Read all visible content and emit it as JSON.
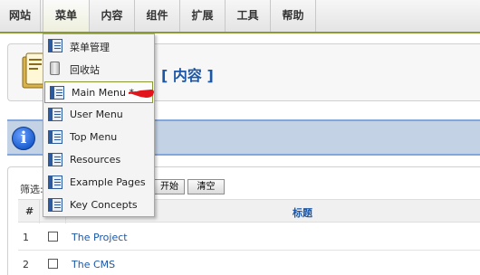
{
  "menubar": {
    "items": [
      {
        "label": "网站"
      },
      {
        "label": "菜单"
      },
      {
        "label": "内容"
      },
      {
        "label": "组件"
      },
      {
        "label": "扩展"
      },
      {
        "label": "工具"
      },
      {
        "label": "帮助"
      }
    ]
  },
  "header": {
    "title": "[ 内容 ]"
  },
  "dropdown": {
    "items": [
      {
        "label": "菜单管理",
        "icon": "menu-list-icon"
      },
      {
        "label": "回收站",
        "icon": "trash-icon"
      },
      {
        "label": "Main Menu *",
        "icon": "menu-list-icon"
      },
      {
        "label": "User Menu",
        "icon": "menu-list-icon"
      },
      {
        "label": "Top Menu",
        "icon": "menu-list-icon"
      },
      {
        "label": "Resources",
        "icon": "menu-list-icon"
      },
      {
        "label": "Example Pages",
        "icon": "menu-list-icon"
      },
      {
        "label": "Key Concepts",
        "icon": "menu-list-icon"
      }
    ]
  },
  "filter": {
    "label": "筛选:",
    "go_label": "开始",
    "reset_label": "清空"
  },
  "table": {
    "headers": {
      "num": "#",
      "title": "标题"
    },
    "rows": [
      {
        "num": "1",
        "title": "The Project"
      },
      {
        "num": "2",
        "title": "The CMS"
      }
    ]
  },
  "colors": {
    "accent_green": "#8c9a35",
    "link_blue": "#1b57a6",
    "message_bg": "#c3d2e5"
  }
}
